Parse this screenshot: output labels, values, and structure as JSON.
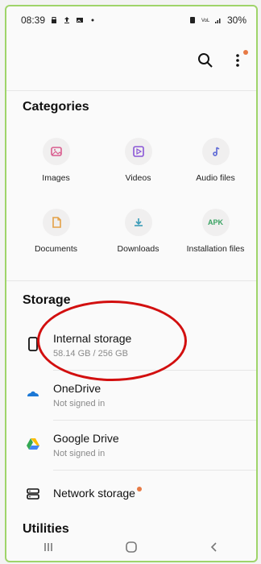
{
  "status_bar": {
    "time": "08:39",
    "battery": "30%"
  },
  "appbar": {
    "search_icon": "search-icon",
    "more_icon": "more-vert-icon"
  },
  "categories": {
    "title": "Categories",
    "items": [
      {
        "label": "Images",
        "icon": "image-icon"
      },
      {
        "label": "Videos",
        "icon": "video-icon"
      },
      {
        "label": "Audio files",
        "icon": "audio-icon"
      },
      {
        "label": "Documents",
        "icon": "document-icon"
      },
      {
        "label": "Downloads",
        "icon": "download-icon"
      },
      {
        "label": "Installation files",
        "icon": "apk-icon",
        "apk_text": "APK"
      }
    ]
  },
  "storage": {
    "title": "Storage",
    "items": [
      {
        "title": "Internal storage",
        "subtitle": "58.14 GB / 256 GB",
        "icon": "phone-icon"
      },
      {
        "title": "OneDrive",
        "subtitle": "Not signed in",
        "icon": "onedrive-icon"
      },
      {
        "title": "Google Drive",
        "subtitle": "Not signed in",
        "icon": "google-drive-icon"
      },
      {
        "title": "Network storage",
        "subtitle": "",
        "icon": "network-storage-icon"
      }
    ]
  },
  "utilities": {
    "title": "Utilities"
  },
  "colors": {
    "accent_orange": "#e77a45",
    "annotation_red": "#d20f0f",
    "pink": "#d95c8e",
    "purple": "#8a56d6",
    "green": "#3aa363"
  }
}
